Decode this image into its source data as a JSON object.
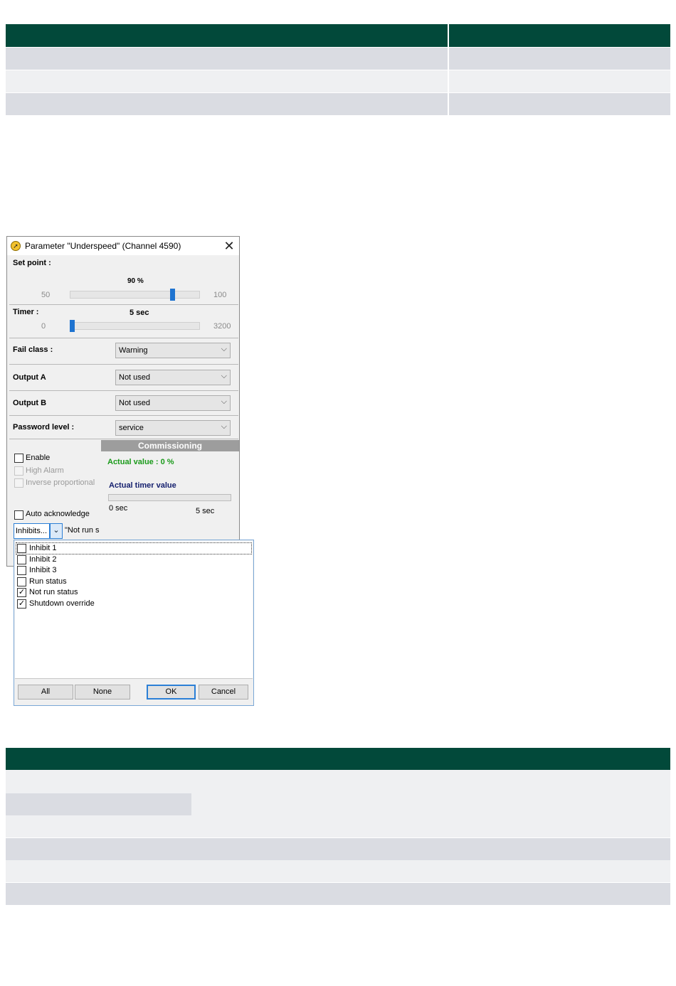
{
  "dialog": {
    "title": "Parameter \"Underspeed\" (Channel 4590)",
    "close": "✕",
    "set_point": {
      "label": "Set point :",
      "value_text": "90 %",
      "min": "50",
      "max": "100",
      "value": 90,
      "range": [
        50,
        100
      ]
    },
    "timer": {
      "label": "Timer :",
      "value_text": "5 sec",
      "min": "0",
      "max": "3200",
      "value": 5,
      "range": [
        0,
        3200
      ]
    },
    "fail_class": {
      "label": "Fail class :",
      "value": "Warning"
    },
    "output_a": {
      "label": "Output A",
      "value": "Not used"
    },
    "output_b": {
      "label": "Output B",
      "value": "Not used"
    },
    "password_level": {
      "label": "Password level :",
      "value": "service"
    },
    "checks": {
      "enable": "Enable",
      "high_alarm": "High Alarm",
      "inverse_proportional": "Inverse proportional",
      "auto_acknowledge": "Auto acknowledge"
    },
    "commissioning": {
      "header": "Commissioning",
      "actual_value": "Actual value : 0 %",
      "timer_label": "Actual timer value",
      "timer_min": "0 sec",
      "timer_max": "5 sec"
    },
    "inhibits": {
      "button": "Inhibits...",
      "dropdown": "⌄",
      "summary": "\"Not run s"
    }
  },
  "popup": {
    "items": [
      {
        "label": "Inhibit 1",
        "checked": false
      },
      {
        "label": "Inhibit 2",
        "checked": false
      },
      {
        "label": "Inhibit 3",
        "checked": false
      },
      {
        "label": "Run status",
        "checked": false
      },
      {
        "label": "Not run status",
        "checked": true
      },
      {
        "label": "Shutdown override",
        "checked": true
      }
    ],
    "check_mark": "✓",
    "buttons": {
      "all": "All",
      "none": "None",
      "ok": "OK",
      "cancel": "Cancel"
    }
  },
  "icons": {
    "title": "compass-icon",
    "chevron": "chevron-down-icon"
  },
  "colors": {
    "header_green": "#02493a",
    "row_shade": "#dadce2",
    "row_light": "#eff0f2",
    "slider_blue": "#1e73d0"
  }
}
